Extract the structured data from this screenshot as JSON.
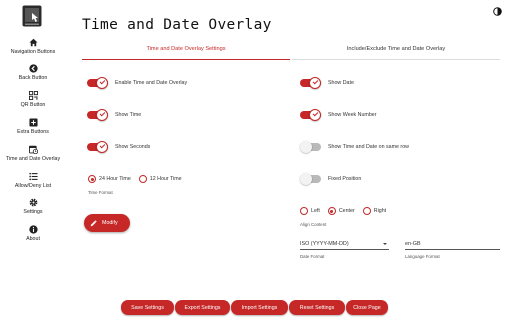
{
  "app": {
    "title": "Time and Date Overlay",
    "accent_color": "#c62828",
    "logo_icon": "hand-pointer-logo"
  },
  "sidebar": {
    "items": [
      {
        "label": "Navigation Buttons",
        "icon": "home-icon"
      },
      {
        "label": "Back Button",
        "icon": "back-arrow-icon"
      },
      {
        "label": "QR Button",
        "icon": "qr-code-icon"
      },
      {
        "label": "Extra Buttons",
        "icon": "plus-box-icon"
      },
      {
        "label": "Time and Date Overlay",
        "icon": "calendar-clock-icon"
      },
      {
        "label": "Allow/Deny List",
        "icon": "list-icon"
      },
      {
        "label": "Settings",
        "icon": "gear-icon"
      },
      {
        "label": "About",
        "icon": "info-icon"
      }
    ]
  },
  "tabs": [
    {
      "label": "Time and Date Overlay Settings",
      "active": true
    },
    {
      "label": "Include/Exclude Time and Date Overlay",
      "active": false
    }
  ],
  "left_toggles": [
    {
      "label": "Enable Time and Date Overlay",
      "on": true
    },
    {
      "label": "Show Time",
      "on": true
    },
    {
      "label": "Show Seconds",
      "on": true
    }
  ],
  "right_toggles": [
    {
      "label": "Show Date",
      "on": true
    },
    {
      "label": "Show Week Number",
      "on": true
    },
    {
      "label": "Show Time and Date on same row",
      "on": false
    },
    {
      "label": "Fixed Position",
      "on": false
    }
  ],
  "time_format": {
    "caption": "Time Format",
    "options": [
      {
        "label": "24 Hour Time",
        "checked": true
      },
      {
        "label": "12 Hour Time",
        "checked": false
      }
    ]
  },
  "align_content": {
    "caption": "Align Content",
    "options": [
      {
        "label": "Left",
        "checked": false
      },
      {
        "label": "Center",
        "checked": true
      },
      {
        "label": "Right",
        "checked": false
      }
    ]
  },
  "modify_button": {
    "label": "Modify"
  },
  "date_format": {
    "value": "ISO (YYYY-MM-DD)",
    "caption": "Date Format"
  },
  "language_format": {
    "value": "en-GB",
    "caption": "Language Format"
  },
  "bottom_buttons": [
    "Save Settings",
    "Export Settings",
    "Import Settings",
    "Reset Settings",
    "Close Page"
  ]
}
